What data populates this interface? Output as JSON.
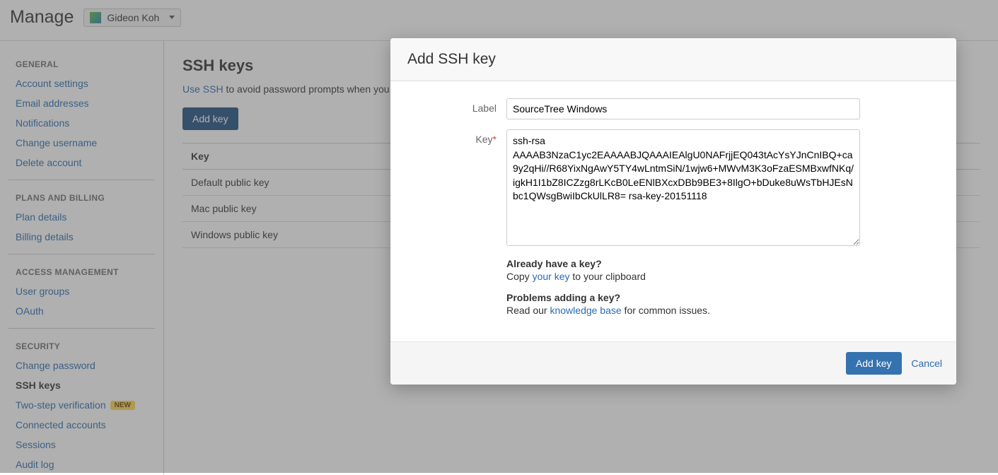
{
  "topbar": {
    "title": "Manage",
    "user_name": "Gideon Koh"
  },
  "sidebar": {
    "sections": [
      {
        "title": "GENERAL",
        "items": [
          {
            "label": "Account settings"
          },
          {
            "label": "Email addresses"
          },
          {
            "label": "Notifications"
          },
          {
            "label": "Change username"
          },
          {
            "label": "Delete account"
          }
        ]
      },
      {
        "title": "PLANS AND BILLING",
        "items": [
          {
            "label": "Plan details"
          },
          {
            "label": "Billing details"
          }
        ]
      },
      {
        "title": "ACCESS MANAGEMENT",
        "items": [
          {
            "label": "User groups"
          },
          {
            "label": "OAuth"
          }
        ]
      },
      {
        "title": "SECURITY",
        "items": [
          {
            "label": "Change password"
          },
          {
            "label": "SSH keys",
            "active": true
          },
          {
            "label": "Two-step verification",
            "badge": "NEW"
          },
          {
            "label": "Connected accounts"
          },
          {
            "label": "Sessions"
          },
          {
            "label": "Audit log"
          }
        ]
      }
    ]
  },
  "main": {
    "heading": "SSH keys",
    "desc_link": "Use SSH",
    "desc_rest": " to avoid password prompts when you",
    "add_key_btn": "Add key",
    "table_header": "Key",
    "keys": [
      "Default public key",
      "Mac public key",
      "Windows public key"
    ]
  },
  "modal": {
    "title": "Add SSH key",
    "label_label": "Label",
    "label_value": "SourceTree Windows",
    "key_label": "Key",
    "key_value": "ssh-rsa AAAAB3NzaC1yc2EAAAABJQAAAIEAlgU0NAFrjjEQ043tAcYsYJnCnIBQ+ca9y2qHi//R68YixNgAwY5TY4wLntmSiN/1wjw6+MWvM3K3oFzaESMBxwfNKq/igkH1I1bZ8ICZzg8rLKcB0LeENlBXcxDBb9BE3+8IlgO+bDuke8uWsTbHJEsNbc1QWsgBwiIbCkUlLR8= rsa-key-20151118",
    "help1_title": "Already have a key?",
    "help1_prefix": "Copy ",
    "help1_link": "your key",
    "help1_suffix": " to your clipboard",
    "help2_title": "Problems adding a key?",
    "help2_prefix": "Read our ",
    "help2_link": "knowledge base",
    "help2_suffix": " for common issues.",
    "submit_btn": "Add key",
    "cancel_btn": "Cancel"
  }
}
